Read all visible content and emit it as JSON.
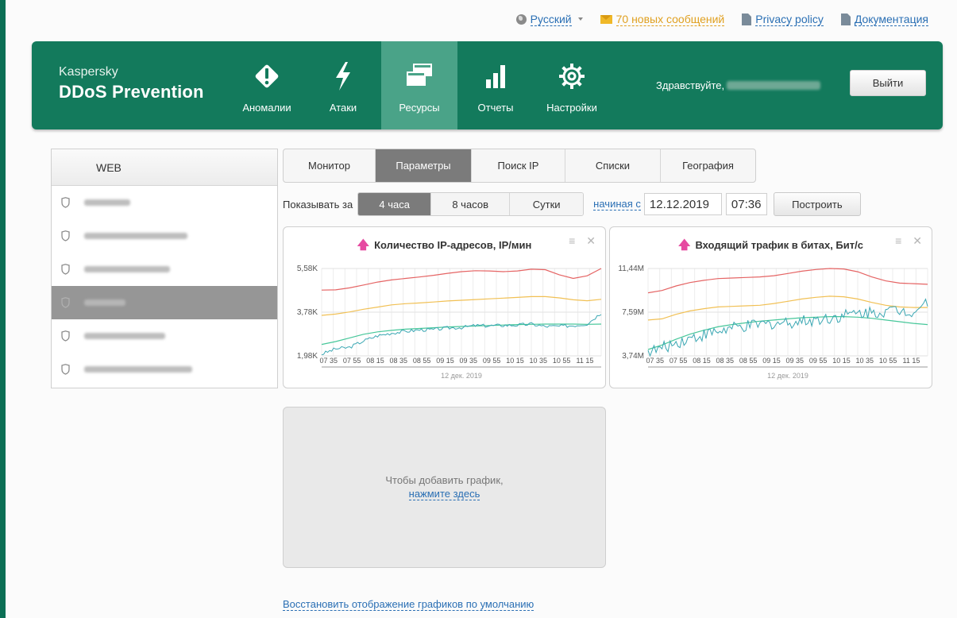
{
  "toplinks": {
    "language": "Русский",
    "messages": "70 новых сообщений",
    "privacy": "Privacy policy",
    "docs": "Документация"
  },
  "brand": {
    "line1": "Kaspersky",
    "line2": "DDoS Prevention"
  },
  "nav": [
    {
      "label": "Аномалии",
      "icon": "alert-diamond-icon"
    },
    {
      "label": "Атаки",
      "icon": "lightning-icon"
    },
    {
      "label": "Ресурсы",
      "icon": "windows-icon",
      "active": true
    },
    {
      "label": "Отчеты",
      "icon": "bar-chart-icon"
    },
    {
      "label": "Настройки",
      "icon": "gear-icon"
    }
  ],
  "user": {
    "greeting": "Здравствуйте,",
    "logout": "Выйти"
  },
  "sidebar": {
    "header": "WEB",
    "active_index": 3
  },
  "tabs": {
    "items": [
      "Монитор",
      "Параметры",
      "Поиск IP",
      "Списки",
      "География"
    ],
    "active_index": 1
  },
  "period": {
    "label": "Показывать за",
    "options": [
      "4 часа",
      "8 часов",
      "Сутки"
    ],
    "active_index": 0,
    "start_label": "начиная с",
    "date": "12.12.2019",
    "time": "07:36",
    "build": "Построить"
  },
  "charts": {
    "date_caption": "12 дек. 2019"
  },
  "chart_data": [
    {
      "type": "line",
      "title": "Количество IP-адресов, IP/мин",
      "y_ticks": [
        "5,58K",
        "3,78K",
        "1,98K"
      ],
      "ylim": [
        1980,
        5580
      ],
      "x_ticks": [
        "07 35",
        "07 55",
        "08 15",
        "08 35",
        "08 55",
        "09 15",
        "09 35",
        "09 55",
        "10 15",
        "10 35",
        "10 55",
        "11 15"
      ],
      "grid": true,
      "series": [
        {
          "values": [
            4690,
            4700,
            4780,
            4900,
            5020,
            5110,
            5170,
            5230,
            5300,
            5380,
            5450,
            5490,
            5480,
            5450,
            5480,
            5550,
            5530,
            5320,
            5170,
            5280,
            5580
          ],
          "color": "#e56464"
        },
        {
          "values": [
            3650,
            3700,
            3790,
            3900,
            3990,
            4080,
            4130,
            4160,
            4200,
            4240,
            4270,
            4300,
            4330,
            4360,
            4390,
            4420,
            4420,
            4370,
            4290,
            4250,
            4310
          ],
          "color": "#f1c054"
        },
        {
          "values": [
            2450,
            2570,
            2720,
            2870,
            2970,
            3030,
            3080,
            3110,
            3140,
            3170,
            3190,
            3210,
            3230,
            3250,
            3270,
            3280,
            3290,
            3290,
            3290,
            3280,
            3290
          ],
          "color": "#47c79a"
        },
        {
          "values": [
            2050,
            2270,
            2330,
            2600,
            2810,
            2920,
            2990,
            3050,
            3060,
            3130,
            3150,
            3230,
            3220,
            3240,
            3250,
            3290,
            3190,
            3200,
            3230,
            3300,
            3750
          ],
          "color": "#3aa7b3"
        }
      ],
      "date_label": "12 дек. 2019"
    },
    {
      "type": "line",
      "title": "Входящий трафик в битах, Бит/с",
      "y_ticks": [
        "11,44M",
        "7,59M",
        "3,74M"
      ],
      "ylim": [
        3740000,
        11440000
      ],
      "x_ticks": [
        "07 35",
        "07 55",
        "08 15",
        "08 35",
        "08 55",
        "09 15",
        "09 35",
        "09 55",
        "10 15",
        "10 35",
        "10 55",
        "11 15"
      ],
      "grid": true,
      "series": [
        {
          "values": [
            9300000,
            9500000,
            9900000,
            10200000,
            10400000,
            10550000,
            10600000,
            10650000,
            10700000,
            10800000,
            11000000,
            11200000,
            11350000,
            11440000,
            11400000,
            11150000,
            10700000,
            10350000,
            10150000,
            10100000,
            10050000
          ],
          "color": "#e56464"
        },
        {
          "values": [
            6900000,
            7000000,
            7400000,
            7700000,
            7900000,
            8050000,
            8100000,
            8150000,
            8200000,
            8350000,
            8550000,
            8750000,
            8900000,
            9000000,
            8950000,
            8750000,
            8450000,
            8200000,
            8050000,
            8000000,
            8000000
          ],
          "color": "#f1c054"
        },
        {
          "values": [
            4300000,
            4700000,
            5200000,
            5650000,
            6000000,
            6300000,
            6500000,
            6650000,
            6800000,
            6900000,
            7000000,
            7100000,
            7150000,
            7200000,
            7200000,
            7150000,
            7050000,
            6900000,
            6750000,
            6600000,
            6500000
          ],
          "color": "#47c79a"
        },
        {
          "values": [
            4100000,
            4400000,
            4900000,
            5300000,
            5600000,
            5900000,
            6150000,
            6300000,
            6500000,
            6600000,
            6700000,
            6800000,
            6950000,
            7100000,
            7300000,
            7500000,
            7600000,
            7700000,
            7750000,
            7700000,
            8600000
          ],
          "color": "#3aa7b3"
        }
      ],
      "date_label": "12 дек. 2019"
    }
  ],
  "addchart": {
    "text": "Чтобы добавить график,",
    "link": "нажмите здесь"
  },
  "restore": "Восстановить отображение графиков по умолчанию"
}
